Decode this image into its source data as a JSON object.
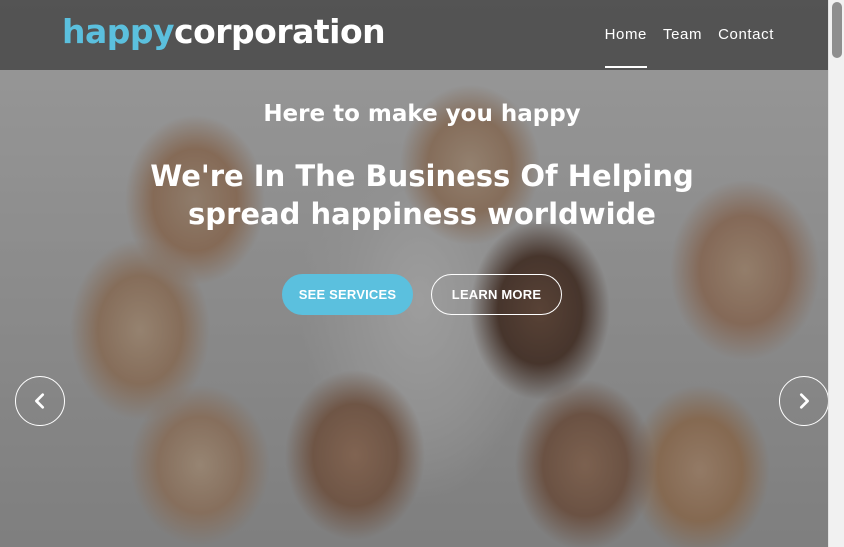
{
  "brand": {
    "part1": "happy",
    "part2": "corporation",
    "accent_color": "#5bc0de"
  },
  "nav": {
    "items": [
      {
        "label": "Home",
        "active": true
      },
      {
        "label": "Team",
        "active": false
      },
      {
        "label": "Contact",
        "active": false
      }
    ]
  },
  "hero": {
    "tagline": "Here to make you happy",
    "headline": "We're In The Business Of Helping spread happiness worldwide",
    "primary_button": "SEE SERVICES",
    "secondary_button": "LEARN MORE",
    "prev_icon": "chevron-left-icon",
    "next_icon": "chevron-right-icon"
  }
}
